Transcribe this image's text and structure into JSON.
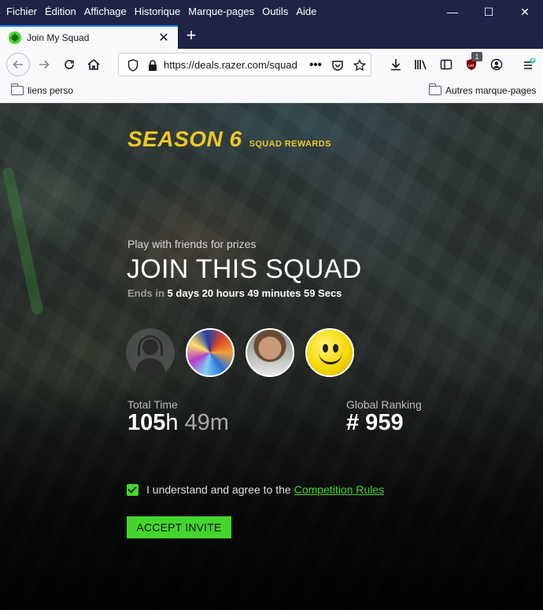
{
  "menubar": {
    "items": [
      "Fichier",
      "Édition",
      "Affichage",
      "Historique",
      "Marque-pages",
      "Outils",
      "Aide"
    ]
  },
  "window_controls": {
    "minimize": "—",
    "maximize": "☐",
    "close": "✕"
  },
  "tab": {
    "title": "Join My Squad",
    "close": "✕",
    "new_tab": "+"
  },
  "toolbar": {
    "url": "https://deals.razer.com/squad",
    "ublock_count": "1",
    "icons": [
      "back-icon",
      "forward-icon",
      "reload-icon",
      "home-icon",
      "shield-icon",
      "lock-icon",
      "more-icon",
      "pocket-icon",
      "star-icon",
      "download-icon",
      "library-icon",
      "sidebar-icon",
      "ublock-icon",
      "account-icon",
      "menu-icon"
    ]
  },
  "bookmarks": {
    "left": "liens perso",
    "right": "Autres marque-pages"
  },
  "page": {
    "season_title": "SEASON 6",
    "season_sub": "SQUAD REWARDS",
    "tagline": "Play with friends for prizes",
    "join_title": "JOIN THIS SQUAD",
    "ends_label": "Ends in",
    "ends_value": "5 days 20 hours 49 minutes 59 Secs",
    "avatars": [
      "default-avatar",
      "colorful-avatar",
      "photo-avatar",
      "smiley-avatar"
    ],
    "total_time_label": "Total Time",
    "total_hours": "105",
    "hours_unit": "h",
    "total_minutes": "49m",
    "ranking_label": "Global Ranking",
    "ranking_value": "# 959",
    "agree_text": "I understand and agree to the",
    "rules_link": "Competition Rules",
    "accept_button": "ACCEPT INVITE",
    "checkbox_checked": true
  },
  "colors": {
    "accent_green": "#44d62c",
    "season_yellow": "#f3c623",
    "menubar_bg": "#1f2346",
    "tab_highlight": "#0a84ff"
  }
}
